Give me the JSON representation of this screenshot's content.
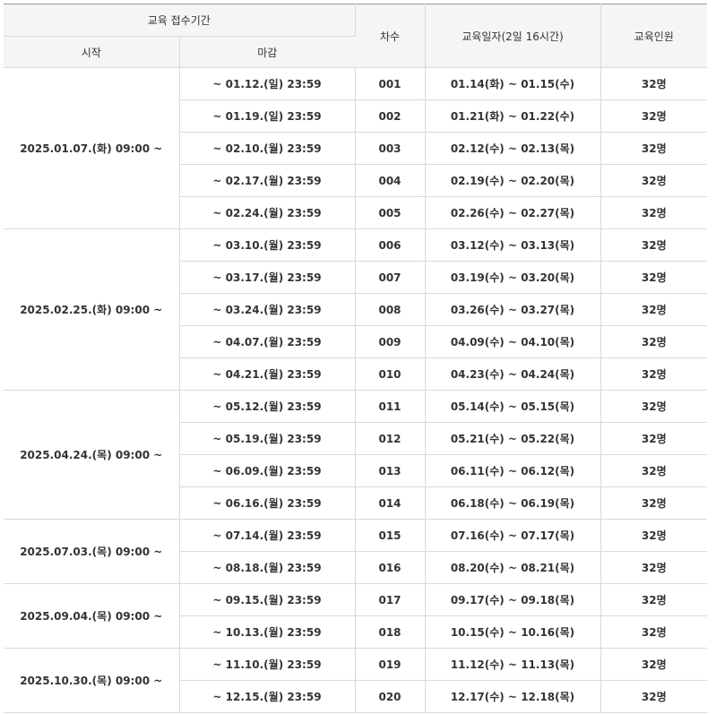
{
  "headers": {
    "period_group": "교육 접수기간",
    "start": "시작",
    "deadline": "마감",
    "round": "차수",
    "edu_date": "교육일자(2일 16시간)",
    "capacity": "교육인원"
  },
  "groups": [
    {
      "start": "2025.01.07.(화) 09:00 ~",
      "rows": [
        {
          "deadline": "~ 01.12.(일) 23:59",
          "round": "001",
          "dates": "01.14(화) ~ 01.15(수)",
          "capacity": "32명"
        },
        {
          "deadline": "~ 01.19.(일) 23:59",
          "round": "002",
          "dates": "01.21(화) ~ 01.22(수)",
          "capacity": "32명"
        },
        {
          "deadline": "~ 02.10.(월) 23:59",
          "round": "003",
          "dates": "02.12(수) ~ 02.13(목)",
          "capacity": "32명"
        },
        {
          "deadline": "~ 02.17.(월) 23:59",
          "round": "004",
          "dates": "02.19(수) ~ 02.20(목)",
          "capacity": "32명"
        },
        {
          "deadline": "~ 02.24.(월) 23:59",
          "round": "005",
          "dates": "02.26(수) ~ 02.27(목)",
          "capacity": "32명"
        }
      ]
    },
    {
      "start": "2025.02.25.(화) 09:00 ~",
      "rows": [
        {
          "deadline": "~ 03.10.(월) 23:59",
          "round": "006",
          "dates": "03.12(수) ~ 03.13(목)",
          "capacity": "32명"
        },
        {
          "deadline": "~ 03.17.(월) 23:59",
          "round": "007",
          "dates": "03.19(수) ~ 03.20(목)",
          "capacity": "32명"
        },
        {
          "deadline": "~ 03.24.(월) 23:59",
          "round": "008",
          "dates": "03.26(수) ~ 03.27(목)",
          "capacity": "32명"
        },
        {
          "deadline": "~ 04.07.(월) 23:59",
          "round": "009",
          "dates": "04.09(수) ~ 04.10(목)",
          "capacity": "32명"
        },
        {
          "deadline": "~ 04.21.(월) 23:59",
          "round": "010",
          "dates": "04.23(수) ~ 04.24(목)",
          "capacity": "32명"
        }
      ]
    },
    {
      "start": "2025.04.24.(목) 09:00 ~",
      "rows": [
        {
          "deadline": "~ 05.12.(월) 23:59",
          "round": "011",
          "dates": "05.14(수) ~ 05.15(목)",
          "capacity": "32명"
        },
        {
          "deadline": "~ 05.19.(월) 23:59",
          "round": "012",
          "dates": "05.21(수) ~ 05.22(목)",
          "capacity": "32명"
        },
        {
          "deadline": "~ 06.09.(월) 23:59",
          "round": "013",
          "dates": "06.11(수) ~ 06.12(목)",
          "capacity": "32명"
        },
        {
          "deadline": "~ 06.16.(월) 23:59",
          "round": "014",
          "dates": "06.18(수) ~ 06.19(목)",
          "capacity": "32명"
        }
      ]
    },
    {
      "start": "2025.07.03.(목) 09:00 ~",
      "rows": [
        {
          "deadline": "~ 07.14.(월) 23:59",
          "round": "015",
          "dates": "07.16(수) ~ 07.17(목)",
          "capacity": "32명"
        },
        {
          "deadline": "~ 08.18.(월) 23:59",
          "round": "016",
          "dates": "08.20(수) ~ 08.21(목)",
          "capacity": "32명"
        }
      ]
    },
    {
      "start": "2025.09.04.(목) 09:00 ~",
      "rows": [
        {
          "deadline": "~ 09.15.(월) 23:59",
          "round": "017",
          "dates": "09.17(수) ~ 09.18(목)",
          "capacity": "32명"
        },
        {
          "deadline": "~ 10.13.(월) 23:59",
          "round": "018",
          "dates": "10.15(수) ~ 10.16(목)",
          "capacity": "32명"
        }
      ]
    },
    {
      "start": "2025.10.30.(목) 09:00 ~",
      "rows": [
        {
          "deadline": "~ 11.10.(월) 23:59",
          "round": "019",
          "dates": "11.12(수) ~ 11.13(목)",
          "capacity": "32명"
        },
        {
          "deadline": "~ 12.15.(월) 23:59",
          "round": "020",
          "dates": "12.17(수) ~ 12.18(목)",
          "capacity": "32명"
        }
      ]
    }
  ]
}
